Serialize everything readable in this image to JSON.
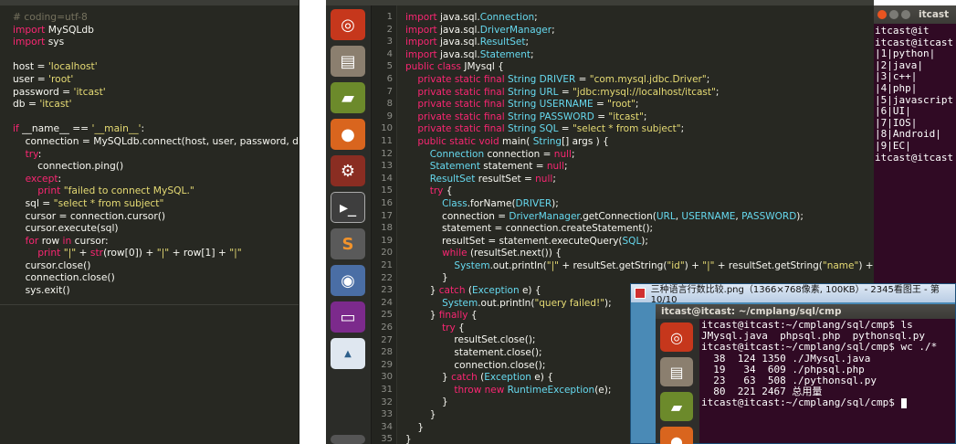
{
  "python": {
    "lines": [
      "# coding=utf-8",
      "import MySQLdb",
      "import sys",
      "",
      "host = 'localhost'",
      "user = 'root'",
      "password = 'itcast'",
      "db = 'itcast'",
      "",
      "if __name__ == '__main__':",
      "    connection = MySQLdb.connect(host, user, password, db)",
      "    try:",
      "        connection.ping()",
      "    except:",
      "        print \"failed to connect MySQL.\"",
      "    sql = \"select * from subject\"",
      "    cursor = connection.cursor()",
      "    cursor.execute(sql)",
      "    for row in cursor:",
      "        print \"|\" + str(row[0]) + \"|\" + row[1] + \"|\"",
      "    cursor.close()",
      "    connection.close()",
      "    sys.exit()"
    ]
  },
  "java": {
    "line_numbers": [
      "1",
      "2",
      "3",
      "4",
      "5",
      "6",
      "7",
      "8",
      "9",
      "10",
      "11",
      "12",
      "13",
      "14",
      "15",
      "16",
      "17",
      "18",
      "19",
      "20",
      "21",
      "22",
      "23",
      "24",
      "25",
      "26",
      "27",
      "28",
      "29",
      "30",
      "31",
      "32",
      "33",
      "34",
      "35"
    ],
    "lines": [
      "import java.sql.Connection;",
      "import java.sql.DriverManager;",
      "import java.sql.ResultSet;",
      "import java.sql.Statement;",
      "public class JMysql {",
      "    private static final String DRIVER = \"com.mysql.jdbc.Driver\";",
      "    private static final String URL = \"jdbc:mysql://localhost/itcast\";",
      "    private static final String USERNAME = \"root\";",
      "    private static final String PASSWORD = \"itcast\";",
      "    private static final String SQL = \"select * from subject\";",
      "    public static void main( String[] args ) {",
      "        Connection connection = null;",
      "        Statement statement = null;",
      "        ResultSet resultSet = null;",
      "        try {",
      "            Class.forName(DRIVER);",
      "            connection = DriverManager.getConnection(URL, USERNAME, PASSWORD);",
      "            statement = connection.createStatement();",
      "            resultSet = statement.executeQuery(SQL);",
      "            while (resultSet.next()) {",
      "                System.out.println(\"|\" + resultSet.getString(\"id\") + \"|\" + resultSet.getString(\"name\") + \"|\");",
      "            }",
      "        } catch (Exception e) {",
      "            System.out.println(\"query failed!\");",
      "        } finally {",
      "            try {",
      "                resultSet.close();",
      "                statement.close();",
      "                connection.close();",
      "            } catch (Exception e) {",
      "                throw new RuntimeException(e);",
      "            }",
      "        }",
      "    }",
      "}"
    ]
  },
  "launcher": {
    "items": [
      "ubuntu-icon",
      "files-icon",
      "book-icon",
      "firefox-icon",
      "settings-icon",
      "terminal-icon",
      "sublime-icon",
      "chrome-icon",
      "app-icon",
      "mysql-workbench-icon"
    ]
  },
  "terminal_top": {
    "title": "itcast",
    "lines": [
      "itcast@it",
      "itcast@itcast",
      "|1|python|",
      "|2|java|",
      "|3|c++|",
      "|4|php|",
      "|5|javascript",
      "|6|UI|",
      "|7|IOS|",
      "|8|Android|",
      "|9|EC|",
      "itcast@itcast"
    ]
  },
  "viewer": {
    "title": "三种语言行数比较.png（1366×768像素, 100KB）- 2345看图王 - 第10/10",
    "terminal_title": "itcast@itcast: ~/cmplang/sql/cmp",
    "lines": [
      "itcast@itcast:~/cmplang/sql/cmp$ ls",
      "JMysql.java  phpsql.php  pythonsql.py",
      "itcast@itcast:~/cmplang/sql/cmp$ wc ./*",
      "  38  124 1350 ./JMysql.java",
      "  19   34  609 ./phpsql.php",
      "  23   63  508 ./pythonsql.py",
      "  80  221 2467 总用量",
      "itcast@itcast:~/cmplang/sql/cmp$ "
    ]
  }
}
